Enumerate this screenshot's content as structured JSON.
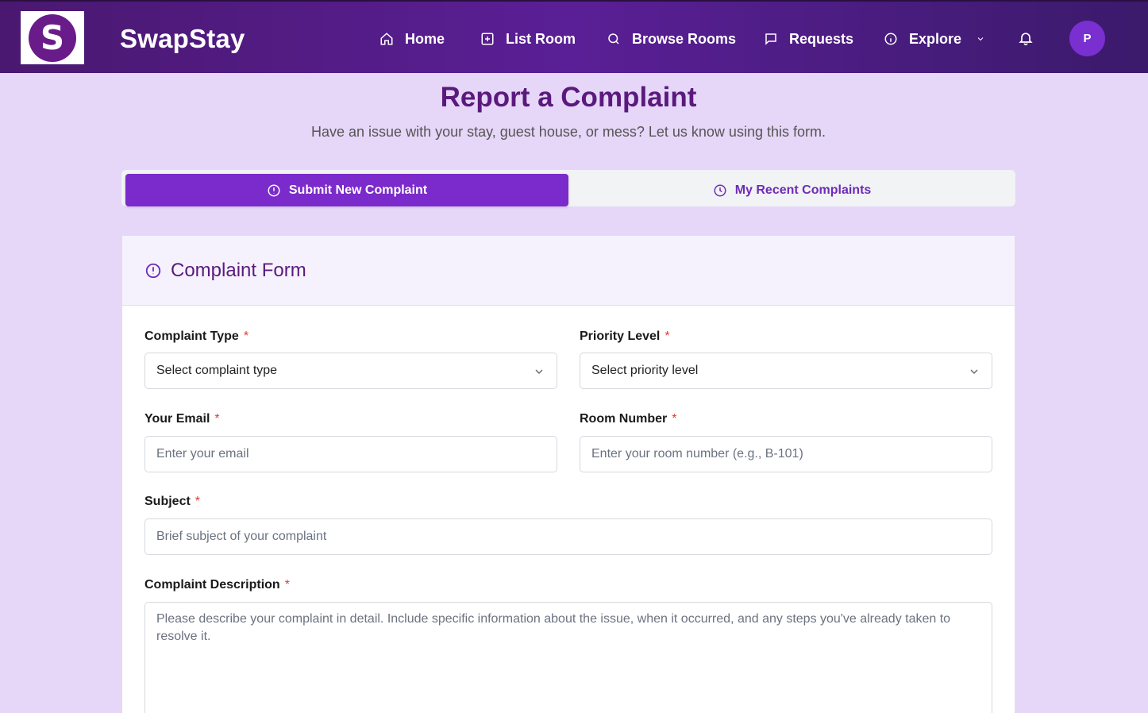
{
  "brand": {
    "logo_letter": "S",
    "name": "SwapStay"
  },
  "nav": {
    "items": [
      {
        "label": "Home",
        "icon": "home-icon"
      },
      {
        "label": "List Room",
        "icon": "plus-square-icon"
      },
      {
        "label": "Browse Rooms",
        "icon": "search-icon"
      },
      {
        "label": "Requests",
        "icon": "message-icon"
      },
      {
        "label": "Explore",
        "icon": "info-icon"
      }
    ],
    "avatar_initial": "P"
  },
  "header": {
    "title": "Report a Complaint",
    "subtitle": "Have an issue with your stay, guest house, or mess? Let us know using this form."
  },
  "tabs": [
    {
      "label": "Submit New Complaint",
      "icon": "alert-circle-icon",
      "active": true
    },
    {
      "label": "My Recent Complaints",
      "icon": "clock-icon",
      "active": false
    }
  ],
  "form": {
    "title": "Complaint Form",
    "required_mark": "*",
    "complaint_type": {
      "label": "Complaint Type",
      "value": "Select complaint type"
    },
    "priority": {
      "label": "Priority Level",
      "value": "Select priority level"
    },
    "email": {
      "label": "Your Email",
      "placeholder": "Enter your email"
    },
    "room": {
      "label": "Room Number",
      "placeholder": "Enter your room number (e.g., B-101)"
    },
    "subject": {
      "label": "Subject",
      "placeholder": "Brief subject of your complaint"
    },
    "description": {
      "label": "Complaint Description",
      "placeholder": "Please describe your complaint in detail. Include specific information about the issue, when it occurred, and any steps you've already taken to resolve it."
    }
  },
  "colors": {
    "primary": "#7b2acb",
    "title": "#5a1a7d",
    "page_bg": "#e6d6f8",
    "required": "#e53935"
  }
}
